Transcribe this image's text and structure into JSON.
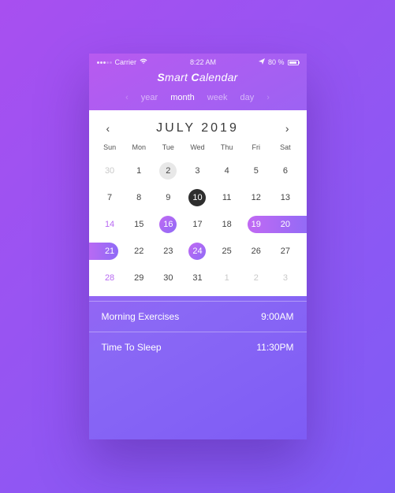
{
  "status": {
    "carrier": "Carrier",
    "wifi_icon": "wifi-icon",
    "time": "8:22 AM",
    "battery_pct": "80 %",
    "send_icon": "send-icon"
  },
  "app": {
    "title_s1": "S",
    "title_rest1": "mart ",
    "title_s2": "C",
    "title_rest2": "alendar"
  },
  "tabs": {
    "prev": "‹",
    "next": "›",
    "items": [
      "year",
      "month",
      "week",
      "day"
    ],
    "active_index": 1
  },
  "month_nav": {
    "prev": "‹",
    "next": "›",
    "title": "JULY 2019"
  },
  "dow": [
    "Sun",
    "Mon",
    "Tue",
    "Wed",
    "Thu",
    "Fri",
    "Sat"
  ],
  "weeks": [
    [
      {
        "n": "30",
        "cls": "other"
      },
      {
        "n": "1"
      },
      {
        "n": "2",
        "cls": "grey-circle"
      },
      {
        "n": "3"
      },
      {
        "n": "4"
      },
      {
        "n": "5"
      },
      {
        "n": "6"
      }
    ],
    [
      {
        "n": "7"
      },
      {
        "n": "8"
      },
      {
        "n": "9"
      },
      {
        "n": "10",
        "cls": "dark-circle"
      },
      {
        "n": "11"
      },
      {
        "n": "12"
      },
      {
        "n": "13"
      }
    ],
    [
      {
        "n": "14",
        "cls": "weekend-hi"
      },
      {
        "n": "15"
      },
      {
        "n": "16",
        "cls": "purple-circle"
      },
      {
        "n": "17"
      },
      {
        "n": "18"
      },
      {
        "n": "19",
        "cls": "on-pill"
      },
      {
        "n": "20",
        "cls": "on-pill"
      }
    ],
    [
      {
        "n": "21",
        "cls": "on-pill"
      },
      {
        "n": "22"
      },
      {
        "n": "23"
      },
      {
        "n": "24",
        "cls": "purple-circle"
      },
      {
        "n": "25"
      },
      {
        "n": "26"
      },
      {
        "n": "27"
      }
    ],
    [
      {
        "n": "28",
        "cls": "weekend-hi"
      },
      {
        "n": "29"
      },
      {
        "n": "30"
      },
      {
        "n": "31"
      },
      {
        "n": "1",
        "cls": "other"
      },
      {
        "n": "2",
        "cls": "other"
      },
      {
        "n": "3",
        "cls": "other"
      }
    ]
  ],
  "events": [
    {
      "title": "Morning Exercises",
      "time": "9:00AM"
    },
    {
      "title": "Time To Sleep",
      "time": "11:30PM"
    }
  ]
}
